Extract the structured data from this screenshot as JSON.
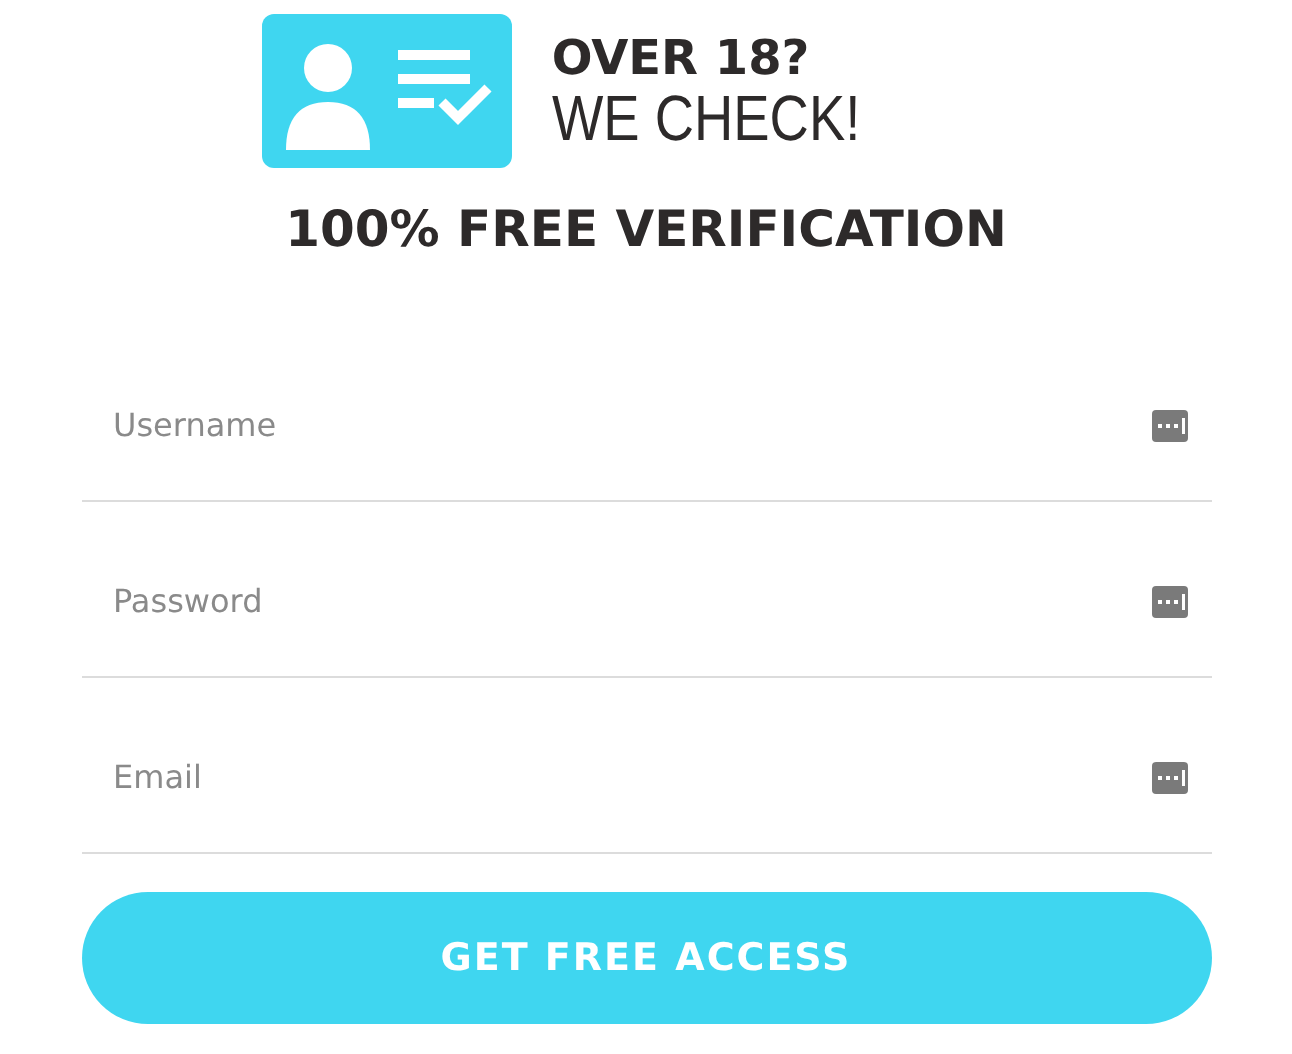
{
  "header": {
    "title_line_1": "OVER 18?",
    "title_line_2": "WE CHECK!"
  },
  "heading": "100% FREE VERIFICATION",
  "fields": [
    {
      "placeholder": "Username"
    },
    {
      "placeholder": "Password"
    },
    {
      "placeholder": "Email"
    }
  ],
  "button": "GET FREE ACCESS"
}
